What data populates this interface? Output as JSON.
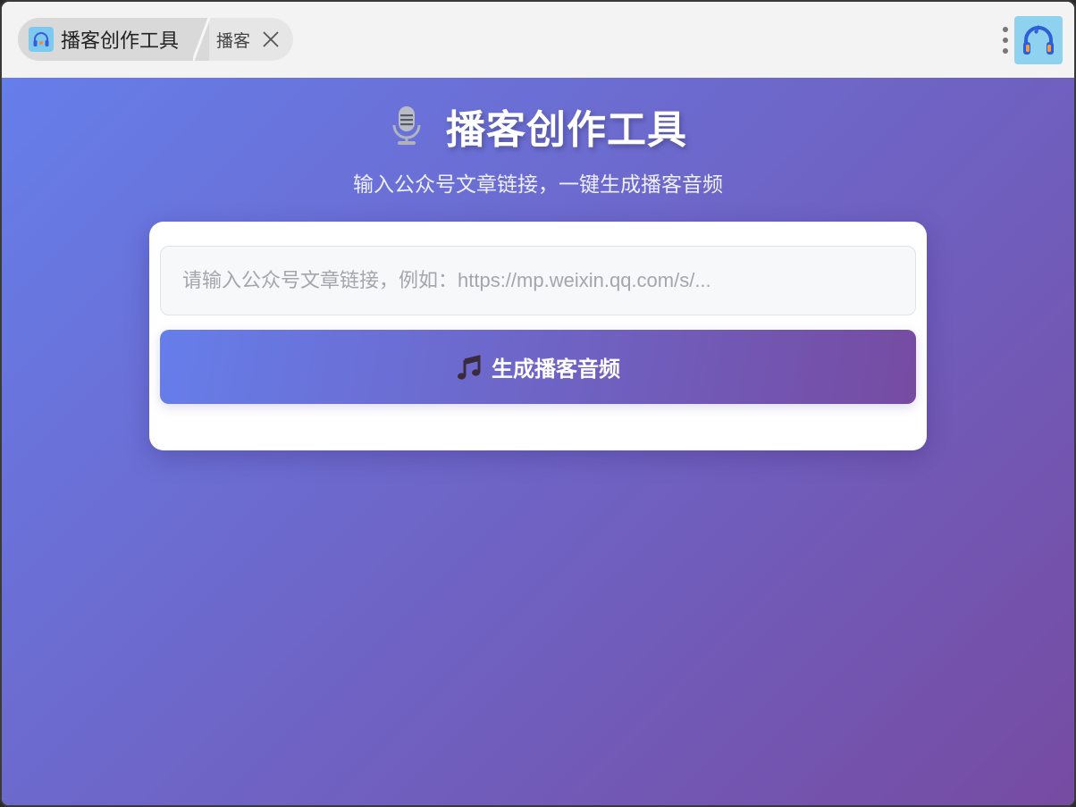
{
  "window": {
    "tab_main_label": "播客创作工具",
    "tab_sub_label": "播客"
  },
  "header": {
    "title": "播客创作工具",
    "subtitle": "输入公众号文章链接，一键生成播客音频"
  },
  "form": {
    "url_value": "",
    "url_placeholder": "请输入公众号文章链接，例如：https://mp.weixin.qq.com/s/...",
    "generate_label": "生成播客音频"
  },
  "icons": {
    "tab_icon": "headphones-icon",
    "close": "close-icon",
    "menu": "kebab-menu-icon",
    "logo": "headphones-music-icon",
    "title": "microphone-icon",
    "button": "music-note-icon"
  },
  "colors": {
    "gradient_start": "#667eea",
    "gradient_end": "#764ba2",
    "card_bg": "#ffffff",
    "titlebar_bg": "#f3f3f3"
  }
}
